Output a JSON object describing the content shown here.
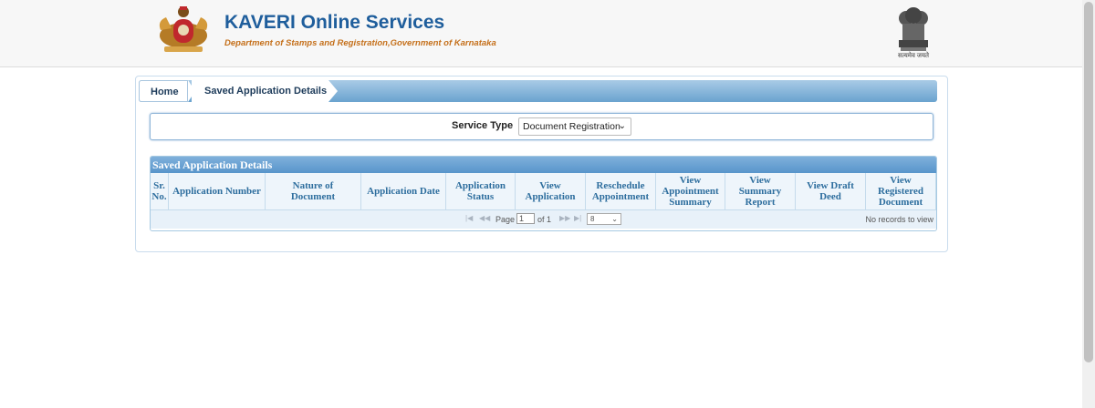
{
  "header": {
    "title": "KAVERI Online Services",
    "subtitle": "Department of Stamps and Registration,Government of Karnataka",
    "emblem_caption": "सत्यमेव जयते",
    "title_color": "#1f5e9c",
    "subtitle_color": "#c5701b"
  },
  "breadcrumb": {
    "home": "Home",
    "current": "Saved Application Details"
  },
  "service": {
    "label": "Service Type",
    "selected": "Document Registration"
  },
  "grid": {
    "caption": "Saved Application Details",
    "columns": [
      "Sr. No.",
      "Application Number",
      "Nature of Document",
      "Application Date",
      "Application Status",
      "View Application",
      "Reschedule Appointment",
      "View Appointment Summary",
      "View Summary Report",
      "View Draft Deed",
      "View Registered Document"
    ],
    "pager": {
      "page_label": "Page",
      "page_value": "1",
      "of_label": "of 1",
      "page_size": "8",
      "records_text": "No records to view"
    }
  }
}
